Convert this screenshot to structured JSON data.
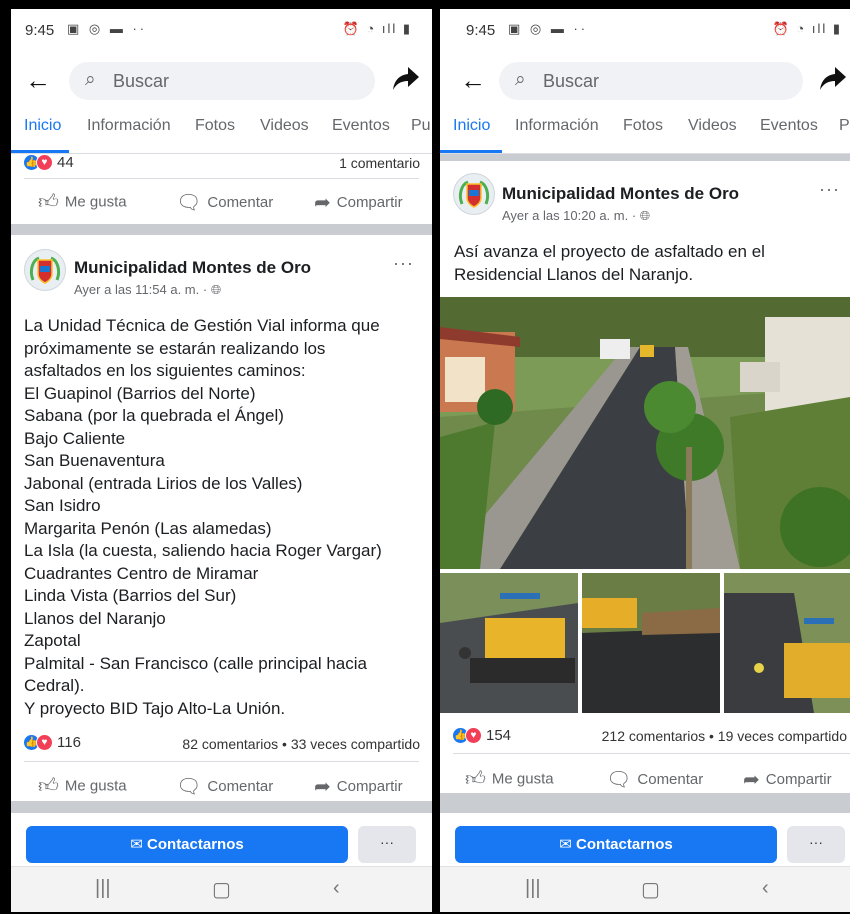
{
  "colors": {
    "accent": "#1877f2",
    "love": "#f33e58",
    "background": "#c9ccd1"
  },
  "status_bar": {
    "time": "9:45"
  },
  "search": {
    "placeholder": "Buscar"
  },
  "tabs": [
    "Inicio",
    "Información",
    "Fotos",
    "Videos",
    "Eventos",
    "Pu"
  ],
  "tabs_right": [
    "Inicio",
    "Información",
    "Fotos",
    "Videos",
    "Eventos",
    "P"
  ],
  "left": {
    "prev_post": {
      "reaction_count": "44",
      "comments": "1 comentario"
    },
    "post": {
      "page_name": "Municipalidad Montes de Oro",
      "time": "Ayer a las 11:54 a. m. ·",
      "lines": [
        "La Unidad Técnica de Gestión Vial informa que",
        "próximamente se estarán realizando los",
        "asfaltados en los siguientes caminos:",
        "El Guapinol (Barrios del Norte)",
        "Sabana (por la quebrada el Ángel)",
        "Bajo Caliente",
        "San Buenaventura",
        "Jabonal (entrada Lirios de los Valles)",
        "San Isidro",
        "Margarita Penón (Las alamedas)",
        "La Isla (la cuesta, saliendo hacia Roger Vargar)",
        "Cuadrantes Centro de Miramar",
        "Linda Vista (Barrios del Sur)",
        "Llanos del Naranjo",
        "Zapotal",
        "Palmital - San Francisco (calle principal hacia",
        "Cedral).",
        "Y proyecto BID Tajo Alto-La Unión."
      ],
      "reaction_count": "116",
      "stats": "82 comentarios • 33 veces compartido"
    }
  },
  "right": {
    "post": {
      "page_name": "Municipalidad Montes de Oro",
      "time": "Ayer a las 10:20 a. m. ·",
      "lines": [
        "Así avanza el proyecto de asfaltado en el",
        "Residencial Llanos del Naranjo."
      ],
      "reaction_count": "154",
      "stats": "212 comentarios • 19 veces compartido"
    }
  },
  "actions": {
    "like": "Me gusta",
    "comment": "Comentar",
    "share": "Compartir"
  },
  "contact": {
    "label": "Contactarnos",
    "more": "···"
  },
  "more_dots": "···",
  "icons": {
    "back": "arrow-left-icon",
    "search": "magnifier-icon",
    "share": "share-arrow-icon",
    "like": "thumbs-up-icon",
    "comment": "speech-bubble-icon",
    "globe": "globe-icon",
    "mail": "envelope-icon"
  }
}
